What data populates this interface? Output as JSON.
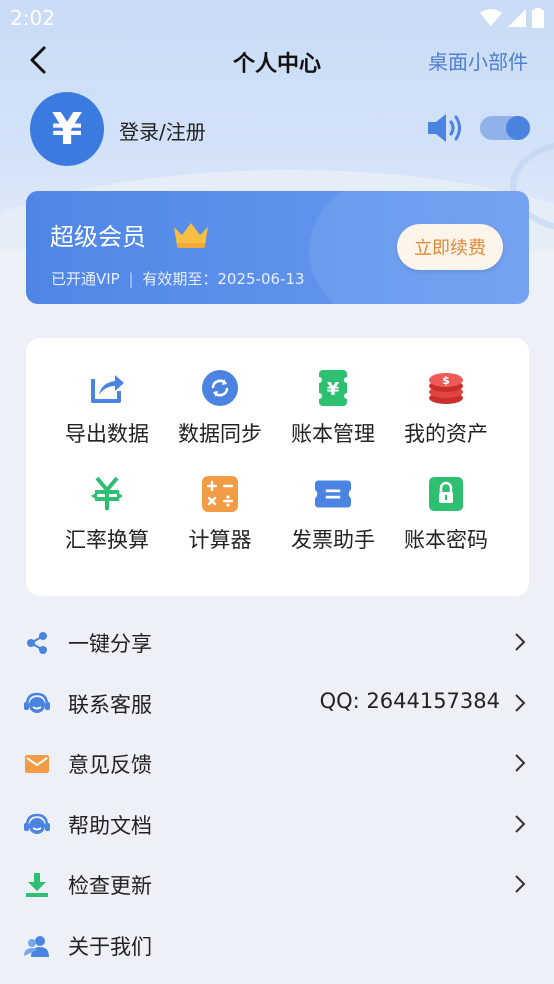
{
  "status": {
    "time": "2:02"
  },
  "header": {
    "title": "个人中心",
    "widget_link": "桌面小部件"
  },
  "profile": {
    "avatar_symbol": "¥",
    "login_text": "登录/注册",
    "sound_on": true
  },
  "vip": {
    "title": "超级会员",
    "status": "已开通VIP",
    "divider": "|",
    "expiry": "有效期至：2025-06-13",
    "renew_label": "立即续费"
  },
  "grid": [
    {
      "label": "导出数据",
      "icon": "export-icon"
    },
    {
      "label": "数据同步",
      "icon": "sync-icon"
    },
    {
      "label": "账本管理",
      "icon": "ledger-icon"
    },
    {
      "label": "我的资产",
      "icon": "assets-icon"
    },
    {
      "label": "汇率换算",
      "icon": "exchange-rate-icon"
    },
    {
      "label": "计算器",
      "icon": "calculator-icon"
    },
    {
      "label": "发票助手",
      "icon": "invoice-icon"
    },
    {
      "label": "账本密码",
      "icon": "lock-icon"
    }
  ],
  "menu": [
    {
      "label": "一键分享",
      "value": "",
      "icon": "share-icon"
    },
    {
      "label": "联系客服",
      "value": "QQ: 2644157384",
      "icon": "customer-service-icon"
    },
    {
      "label": "意见反馈",
      "value": "",
      "icon": "mail-icon"
    },
    {
      "label": "帮助文档",
      "value": "",
      "icon": "help-icon"
    },
    {
      "label": "检查更新",
      "value": "",
      "icon": "download-icon"
    },
    {
      "label": "关于我们",
      "value": "",
      "icon": "about-icon"
    }
  ],
  "colors": {
    "accent": "#3b7be0",
    "vip_gradient_start": "#4f86e6",
    "renew_text": "#e08a3a",
    "link": "#4f7fd3"
  }
}
